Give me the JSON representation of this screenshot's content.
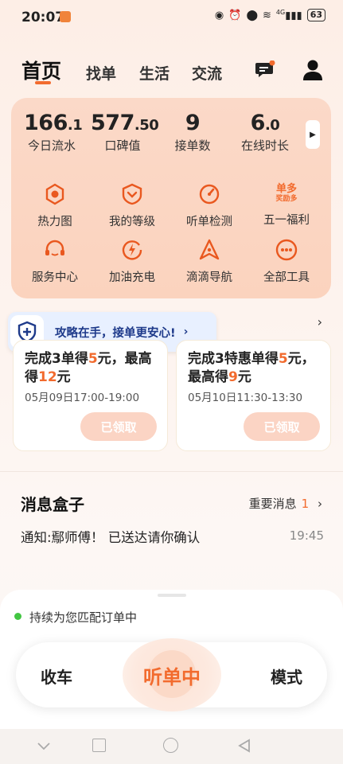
{
  "status_bar": {
    "time": "20:07",
    "battery": "63",
    "network": "4G"
  },
  "top_nav": {
    "tabs": [
      "首页",
      "找单",
      "生活",
      "交流"
    ]
  },
  "stats": [
    {
      "value_main": "166",
      "value_dec": ".1",
      "label": "今日流水"
    },
    {
      "value_main": "577",
      "value_dec": ".50",
      "label": "口碑值"
    },
    {
      "value_main": "9",
      "value_dec": "",
      "label": "接单数"
    },
    {
      "value_main": "6",
      "value_dec": ".0",
      "label": "在线时长"
    }
  ],
  "tools": [
    {
      "label": "热力图",
      "icon": "heatmap-icon"
    },
    {
      "label": "我的等级",
      "icon": "level-icon"
    },
    {
      "label": "听单检测",
      "icon": "gauge-icon"
    },
    {
      "label": "五一福利",
      "icon": "promo-icon",
      "badge_top": "单多",
      "badge_bottom": "奖励多"
    },
    {
      "label": "服务中心",
      "icon": "headset-icon"
    },
    {
      "label": "加油充电",
      "icon": "charge-icon"
    },
    {
      "label": "滴滴导航",
      "icon": "navigation-icon"
    },
    {
      "label": "全部工具",
      "icon": "more-icon"
    }
  ],
  "tip_banner": {
    "text": "攻略在手，接单更安心!"
  },
  "rewards": [
    {
      "title_pre": "完成3单得",
      "title_hl1": "5",
      "title_mid": "元，最高得",
      "title_hl2": "12",
      "title_post": "元",
      "time": "05月09日17:00-19:00",
      "button": "已领取"
    },
    {
      "title_pre": "完成3特惠单得",
      "title_hl1": "5",
      "title_mid": "元，最高得",
      "title_hl2": "9",
      "title_post": "元",
      "time": "05月10日11:30-13:30",
      "button": "已领取"
    }
  ],
  "message_box": {
    "title": "消息盒子",
    "important_label": "重要消息",
    "important_count": "1",
    "notice": "通知:鄢师傅！ 已送达请你确认",
    "notice_time": "19:45"
  },
  "bottom_sheet": {
    "status": "持续为您匹配订单中",
    "left_button": "收车",
    "center_button": "听单中",
    "right_button": "模式"
  },
  "colors": {
    "accent": "#f26b2e",
    "card_bg": "#fbd6c3",
    "tip_text": "#1e3a8a"
  }
}
